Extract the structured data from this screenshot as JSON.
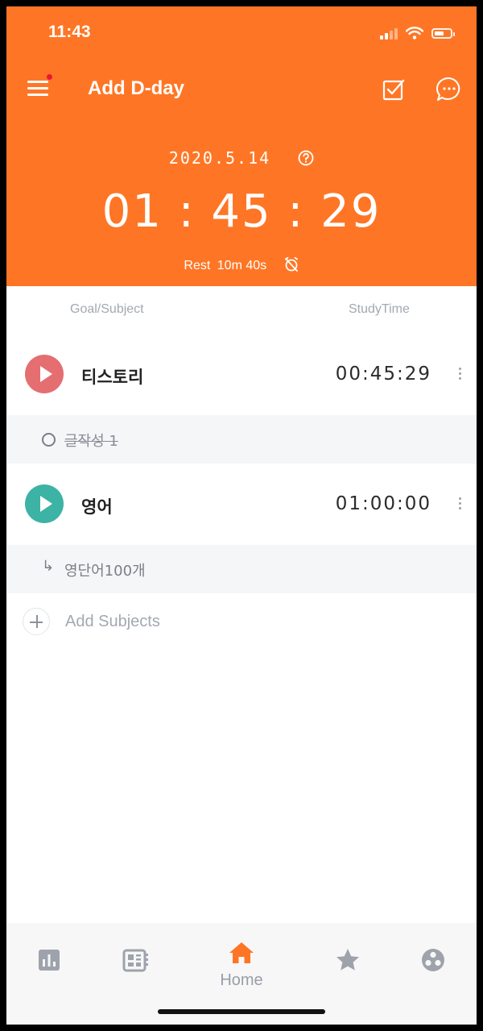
{
  "status_bar": {
    "time": "11:43"
  },
  "header": {
    "title": "Add D-day",
    "date": "2020.5.14",
    "total_time": "01:45:29",
    "rest_label": "Rest",
    "rest_value": "10m 40s"
  },
  "columns": {
    "goal": "Goal/Subject",
    "study": "StudyTime"
  },
  "subjects": [
    {
      "name": "티스토리",
      "time": "00:45:29",
      "color": "#e56e71"
    },
    {
      "name": "영어",
      "time": "01:00:00",
      "color": "#3cb3a4"
    }
  ],
  "tasks": [
    {
      "text": "글작성 1",
      "done": true
    },
    {
      "text": "영단어100개",
      "done": false
    }
  ],
  "add_subjects_label": "Add Subjects",
  "tabbar": {
    "home_label": "Home",
    "active_color": "#fe7625"
  },
  "colors": {
    "brand": "#fe7625"
  }
}
